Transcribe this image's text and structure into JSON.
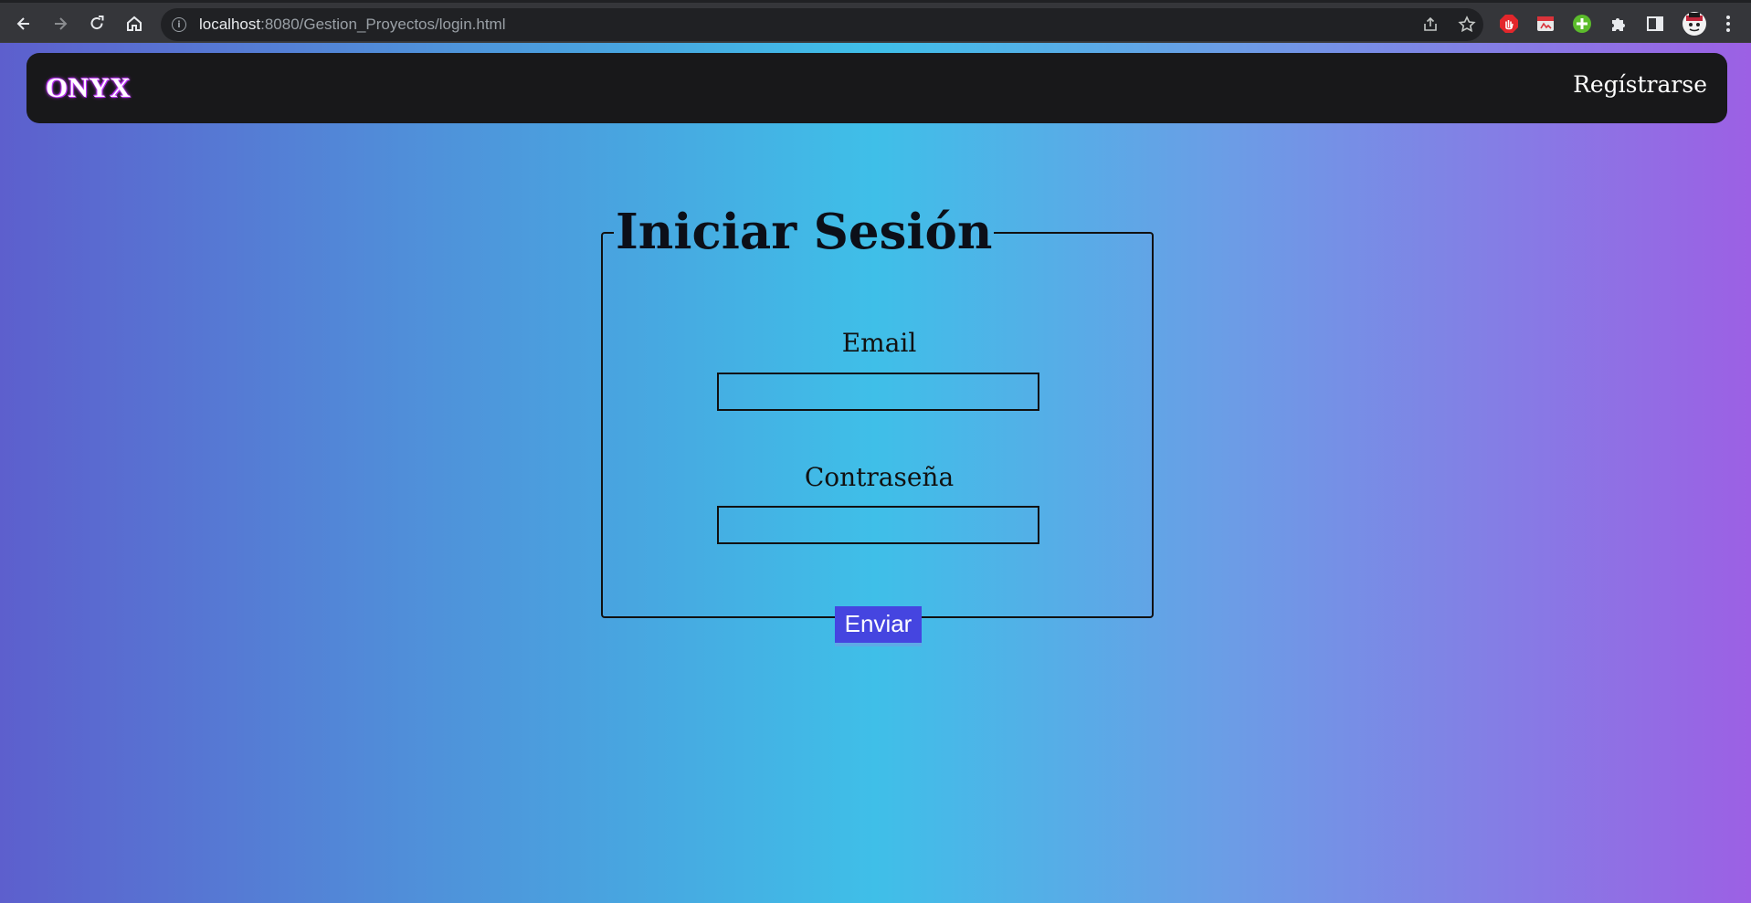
{
  "browser": {
    "url_host": "localhost",
    "url_rest": ":8080/Gestion_Proyectos/login.html",
    "icons": [
      "back-arrow-icon",
      "forward-arrow-icon",
      "reload-icon",
      "home-icon",
      "site-info-icon",
      "share-icon",
      "bookmark-star-icon",
      "adblock-extension-icon",
      "pdf-extension-icon",
      "green-plus-extension-icon",
      "puzzle-extensions-icon",
      "side-panel-icon",
      "profile-avatar-icon",
      "kebab-menu-icon"
    ]
  },
  "navbar": {
    "brand": "ONYX",
    "register_label": "Regístrarse"
  },
  "login_form": {
    "legend": "Iniciar Sesión",
    "email_label": "Email",
    "email_value": "",
    "password_label": "Contraseña",
    "password_value": "",
    "submit_label": "Enviar"
  },
  "colors": {
    "gradient": [
      "#5d5fcd",
      "#3fbfe8",
      "#9c60e4"
    ],
    "navbar_bg": "#18181a",
    "button_bg": "#4545e0",
    "brand_glow": "#c03cff"
  }
}
